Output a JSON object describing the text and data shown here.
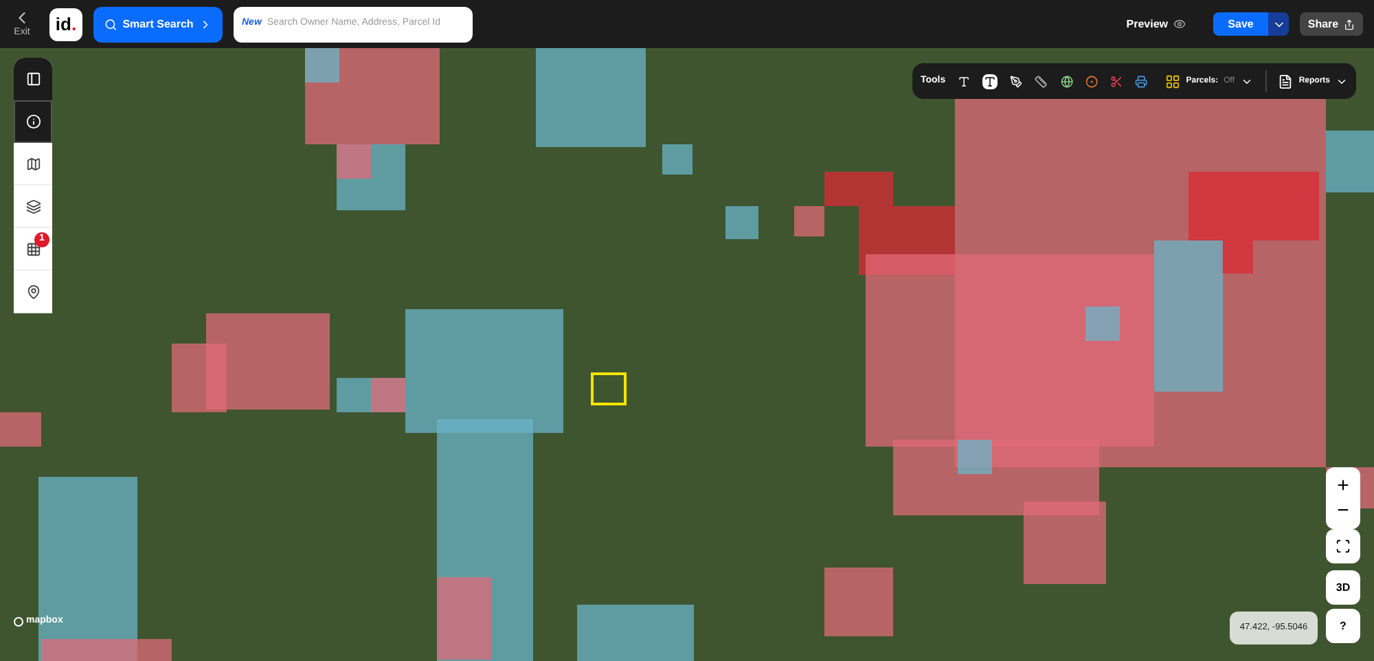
{
  "top_bar": {
    "exit_label": "Exit",
    "logo_text": "id",
    "logo_dot": ".",
    "smart_search": "Smart Search",
    "search": {
      "badge": "New",
      "placeholder": "Search Owner Name, Address, Parcel Id"
    },
    "preview": "Preview",
    "save": "Save",
    "share": "Share"
  },
  "toolbar": {
    "label": "Tools",
    "parcels_label": "Parcels:",
    "parcels_value": "Off",
    "reports": "Reports"
  },
  "sidebar": {
    "items": [
      {
        "kind": "panel",
        "selected": false
      },
      {
        "kind": "info",
        "selected": true
      },
      {
        "kind": "map",
        "selected": false
      },
      {
        "kind": "layers",
        "selected": false
      },
      {
        "kind": "grid",
        "selected": false,
        "badge": "1"
      },
      {
        "kind": "pin",
        "selected": false
      }
    ]
  },
  "map_controls": {
    "zoom_in": "+",
    "zoom_out": "−",
    "three_d": "3D",
    "help": "?",
    "coordinates": "47.422, -95.5046"
  },
  "attribution": "mapbox"
}
